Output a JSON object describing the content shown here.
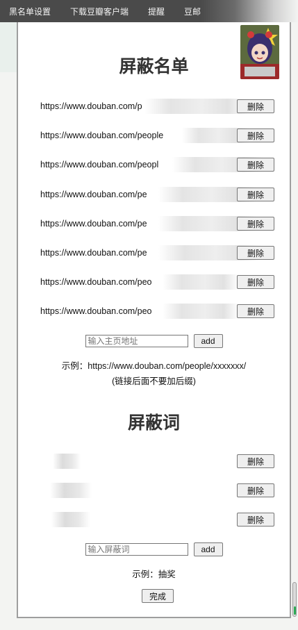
{
  "nav": {
    "items": [
      "黑名单设置",
      "下载豆瓣客户端",
      "提醒",
      "豆邮"
    ]
  },
  "blocklist": {
    "title": "屏蔽名单",
    "urls": [
      "https://www.douban.com/p",
      "https://www.douban.com/people",
      "https://www.douban.com/peopl",
      "https://www.douban.com/pe",
      "https://www.douban.com/pe",
      "https://www.douban.com/pe",
      "https://www.douban.com/peo",
      "https://www.douban.com/peo"
    ],
    "delete_label": "删除",
    "input_placeholder": "输入主页地址",
    "add_label": "add",
    "example_line1": "示例：https://www.douban.com/people/xxxxxxx/",
    "example_line2": "(链接后面不要加后缀)"
  },
  "blockwords": {
    "title": "屏蔽词",
    "count": 3,
    "delete_label": "删除",
    "input_placeholder": "输入屏蔽词",
    "add_label": "add",
    "example": "示例：抽奖"
  },
  "done_label": "完成",
  "colors": {
    "nav_bg": "#4a4a4a",
    "panel_bg": "#ffffff",
    "title": "#333333",
    "scroll_accent": "#2eaa55"
  },
  "icons": {
    "avatar": "anime-avatar"
  }
}
